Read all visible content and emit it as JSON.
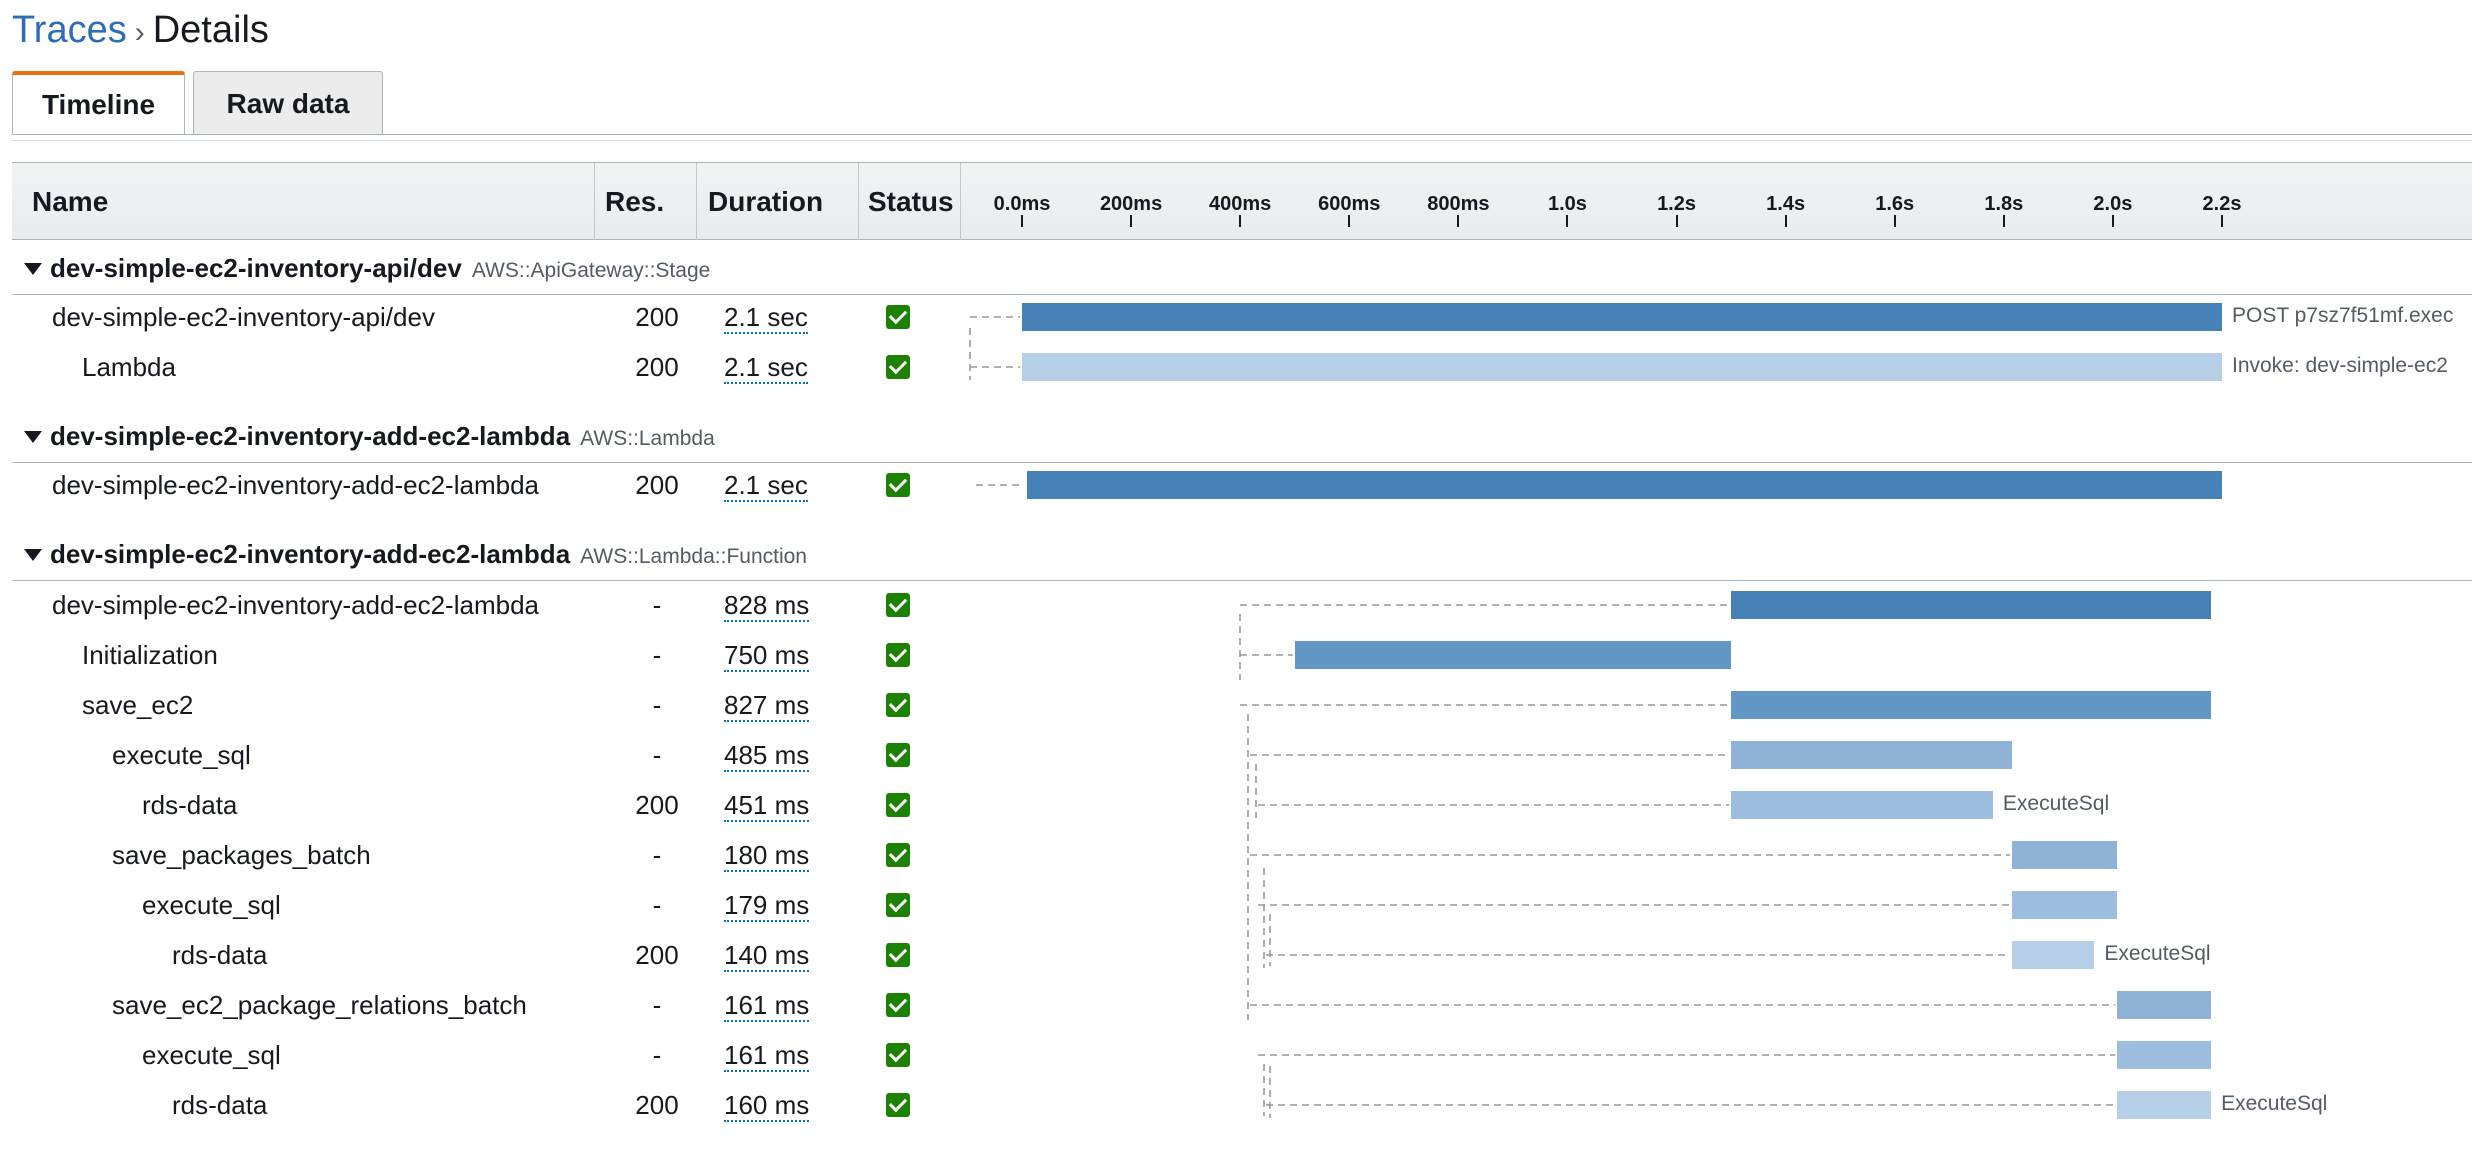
{
  "breadcrumb": {
    "link": "Traces",
    "separator": "›",
    "current": "Details"
  },
  "tabs": [
    {
      "label": "Timeline",
      "active": true
    },
    {
      "label": "Raw data",
      "active": false
    }
  ],
  "table_header": {
    "name": "Name",
    "res": "Res.",
    "duration": "Duration",
    "status": "Status"
  },
  "axis": {
    "ticks": [
      "0.0ms",
      "200ms",
      "400ms",
      "600ms",
      "800ms",
      "1.0s",
      "1.2s",
      "1.4s",
      "1.6s",
      "1.8s",
      "2.0s",
      "2.2s"
    ]
  },
  "colors": {
    "dark": "#4682b8",
    "medium": "#6397c6",
    "light": "#8fb3d7",
    "lighter": "#9cbddd",
    "lightest": "#b6cfe6",
    "status_ok": "#1d8102"
  },
  "groups": [
    {
      "name": "dev-simple-ec2-inventory-api/dev",
      "type": "AWS::ApiGateway::Stage",
      "rows": [
        {
          "name": "dev-simple-ec2-inventory-api/dev",
          "indent": 0,
          "res": "200",
          "duration": "2.1 sec",
          "status": "ok",
          "start_s": 0.0,
          "end_s": 2.2,
          "shade": "dark",
          "label": "POST p7sz7f51mf.exec"
        },
        {
          "name": "Lambda",
          "indent": 1,
          "res": "200",
          "duration": "2.1 sec",
          "status": "ok",
          "start_s": 0.0,
          "end_s": 2.2,
          "shade": "lightest",
          "label": "Invoke: dev-simple-ec2"
        }
      ]
    },
    {
      "name": "dev-simple-ec2-inventory-add-ec2-lambda",
      "type": "AWS::Lambda",
      "rows": [
        {
          "name": "dev-simple-ec2-inventory-add-ec2-lambda",
          "indent": 0,
          "res": "200",
          "duration": "2.1 sec",
          "status": "ok",
          "start_s": 0.01,
          "end_s": 2.2,
          "shade": "dark",
          "label": ""
        }
      ]
    },
    {
      "name": "dev-simple-ec2-inventory-add-ec2-lambda",
      "type": "AWS::Lambda::Function",
      "rows": [
        {
          "name": "dev-simple-ec2-inventory-add-ec2-lambda",
          "indent": 0,
          "res": "-",
          "duration": "828 ms",
          "status": "ok",
          "start_s": 1.3,
          "end_s": 2.18,
          "shade": "dark",
          "label": ""
        },
        {
          "name": "Initialization",
          "indent": 1,
          "res": "-",
          "duration": "750 ms",
          "status": "ok",
          "start_s": 0.5,
          "end_s": 1.3,
          "shade": "medium",
          "label": ""
        },
        {
          "name": "save_ec2",
          "indent": 1,
          "res": "-",
          "duration": "827 ms",
          "status": "ok",
          "start_s": 1.3,
          "end_s": 2.18,
          "shade": "medium",
          "label": ""
        },
        {
          "name": "execute_sql",
          "indent": 2,
          "res": "-",
          "duration": "485 ms",
          "status": "ok",
          "start_s": 1.3,
          "end_s": 1.815,
          "shade": "light",
          "label": ""
        },
        {
          "name": "rds-data",
          "indent": 3,
          "res": "200",
          "duration": "451 ms",
          "status": "ok",
          "start_s": 1.3,
          "end_s": 1.78,
          "shade": "lighter",
          "label": "ExecuteSql"
        },
        {
          "name": "save_packages_batch",
          "indent": 2,
          "res": "-",
          "duration": "180 ms",
          "status": "ok",
          "start_s": 1.815,
          "end_s": 2.008,
          "shade": "light",
          "label": ""
        },
        {
          "name": "execute_sql",
          "indent": 3,
          "res": "-",
          "duration": "179 ms",
          "status": "ok",
          "start_s": 1.815,
          "end_s": 2.008,
          "shade": "lighter",
          "label": ""
        },
        {
          "name": "rds-data",
          "indent": 4,
          "res": "200",
          "duration": "140 ms",
          "status": "ok",
          "start_s": 1.815,
          "end_s": 1.966,
          "shade": "lightest",
          "label": "ExecuteSql"
        },
        {
          "name": "save_ec2_package_relations_batch",
          "indent": 2,
          "res": "-",
          "duration": "161 ms",
          "status": "ok",
          "start_s": 2.008,
          "end_s": 2.18,
          "shade": "light",
          "label": ""
        },
        {
          "name": "execute_sql",
          "indent": 3,
          "res": "-",
          "duration": "161 ms",
          "status": "ok",
          "start_s": 2.008,
          "end_s": 2.18,
          "shade": "lighter",
          "label": ""
        },
        {
          "name": "rds-data",
          "indent": 4,
          "res": "200",
          "duration": "160 ms",
          "status": "ok",
          "start_s": 2.008,
          "end_s": 2.18,
          "shade": "lightest",
          "label": "ExecuteSql"
        }
      ]
    }
  ]
}
